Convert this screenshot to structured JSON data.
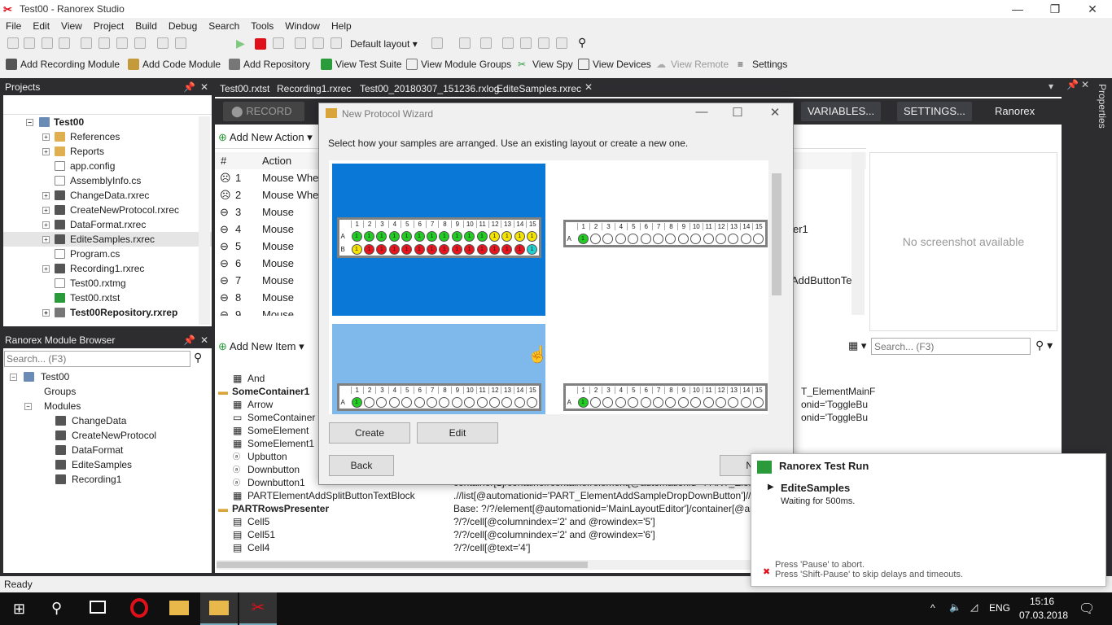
{
  "window": {
    "title": "Test00 - Ranorex Studio",
    "controls": [
      "—",
      "❐",
      "✕"
    ]
  },
  "menu": [
    "File",
    "Edit",
    "View",
    "Project",
    "Build",
    "Debug",
    "Search",
    "Tools",
    "Window",
    "Help"
  ],
  "toolbar1": {
    "layout": "Default layout"
  },
  "toolbar2": {
    "add_recording_module": "Add Recording Module",
    "add_code_module": "Add Code Module",
    "add_repository": "Add Repository",
    "view_test_suite": "View Test Suite",
    "view_module_groups": "View Module Groups",
    "view_spy": "View Spy",
    "view_devices": "View Devices",
    "view_remote": "View Remote",
    "settings": "Settings"
  },
  "projects": {
    "title": "Projects",
    "root": "Test00",
    "items": [
      "References",
      "Reports",
      "app.config",
      "AssemblyInfo.cs",
      "ChangeData.rxrec",
      "CreateNewProtocol.rxrec",
      "DataFormat.rxrec",
      "EditeSamples.rxrec",
      "Program.cs",
      "Recording1.rxrec",
      "Test00.rxtmg",
      "Test00.rxtst",
      "Test00Repository.rxrep"
    ]
  },
  "module_browser": {
    "title": "Ranorex Module Browser",
    "search_placeholder": "Search... (F3)",
    "root": "Test00",
    "groups": "Groups",
    "modules": "Modules",
    "items": [
      "ChangeData",
      "CreateNewProtocol",
      "DataFormat",
      "EditeSamples",
      "Recording1"
    ]
  },
  "tabs": [
    "Test00.rxtst",
    "Recording1.rxrec",
    "Test00_20180307_151236.rxlog",
    "EditeSamples.rxrec"
  ],
  "recorder": {
    "record": "RECORD",
    "variables": "VARIABLES...",
    "settings": "SETTINGS...",
    "brand": "Ranorex",
    "add_new_action": "Add New Action",
    "col_num": "#",
    "col_action": "Action",
    "actions": [
      {
        "n": "1",
        "a": "Mouse Whe"
      },
      {
        "n": "2",
        "a": "Mouse Whe"
      },
      {
        "n": "3",
        "a": "Mouse"
      },
      {
        "n": "4",
        "a": "Mouse"
      },
      {
        "n": "5",
        "a": "Mouse"
      },
      {
        "n": "6",
        "a": "Mouse"
      },
      {
        "n": "7",
        "a": "Mouse"
      },
      {
        "n": "8",
        "a": "Mouse"
      },
      {
        "n": "9",
        "a": "Mouse"
      }
    ],
    "right_col_1": "er1",
    "right_col_2": "AddButtonTe",
    "no_screenshot": "No screenshot available"
  },
  "repository": {
    "add_new_item": "Add New Item",
    "search_placeholder": "Search... (F3)",
    "items": [
      {
        "name": "And",
        "path": ""
      },
      {
        "name": "SomeContainer1",
        "path": "",
        "bold": true
      },
      {
        "name": "Arrow",
        "path": ""
      },
      {
        "name": "SomeContainer",
        "path": ""
      },
      {
        "name": "SomeElement",
        "path": ""
      },
      {
        "name": "SomeElement1",
        "path": ""
      },
      {
        "name": "Upbutton",
        "path": ""
      },
      {
        "name": "Downbutton",
        "path": ""
      },
      {
        "name": "Downbutton1",
        "path": "container[1]/container/container/element[@automationid='PART_ElementK"
      },
      {
        "name": "PARTElementAddSplitButtonTextBlock",
        "path": ".//list[@automationid='PART_ElementAddSampleDropDownButton']//button["
      },
      {
        "name": "PARTRowsPresenter",
        "path": "Base: ?/?/element[@automationid='MainLayoutEditor']/container[@automati",
        "bold": true
      },
      {
        "name": "Cell5",
        "path": "?/?/cell[@columnindex='2' and @rowindex='5']"
      },
      {
        "name": "Cell51",
        "path": "?/?/cell[@columnindex='2' and @rowindex='6']"
      },
      {
        "name": "Cell4",
        "path": "?/?/cell[@text='4']"
      }
    ],
    "right_paths": [
      "T_ElementMainF",
      "onid='ToggleBu",
      "onid='ToggleBu"
    ]
  },
  "dialog": {
    "title": "New Protocol Wizard",
    "instruction": "Select how your samples are arranged. Use an existing layout or create a new one.",
    "create": "Create",
    "edit": "Edit",
    "back": "Back",
    "next": "Ne",
    "columns": [
      "1",
      "2",
      "3",
      "4",
      "5",
      "6",
      "7",
      "8",
      "9",
      "10",
      "11",
      "12",
      "13",
      "14",
      "15"
    ],
    "row_a": "A",
    "row_b": "B",
    "tile1_row_a": [
      "#22cc22",
      "#22cc22",
      "#22cc22",
      "#22cc22",
      "#22cc22",
      "#22cc22",
      "#22cc22",
      "#22cc22",
      "#22cc22",
      "#22cc22",
      "#22cc22",
      "#f5e400",
      "#f5e400",
      "#f5e400",
      "#f5e400"
    ],
    "tile1_row_b": [
      "#f5e400",
      "#e8141e",
      "#e8141e",
      "#e8141e",
      "#e8141e",
      "#e8141e",
      "#e8141e",
      "#e8141e",
      "#e8141e",
      "#e8141e",
      "#e8141e",
      "#e8141e",
      "#e8141e",
      "#e8141e",
      "#22d0d0"
    ],
    "mark": "1",
    "colors": {
      "selected": "#0a78d7",
      "hover": "#7fb8ea"
    }
  },
  "toast": {
    "title": "Ranorex Test Run",
    "item": "EditeSamples",
    "status": "Waiting for 500ms.",
    "hint1": "Press 'Pause' to abort.",
    "hint2": "Press 'Shift-Pause' to skip delays and timeouts."
  },
  "status": "Ready",
  "taskbar": {
    "lang": "ENG",
    "time": "15:16",
    "date": "07.03.2018"
  },
  "side_tab": "Properties"
}
